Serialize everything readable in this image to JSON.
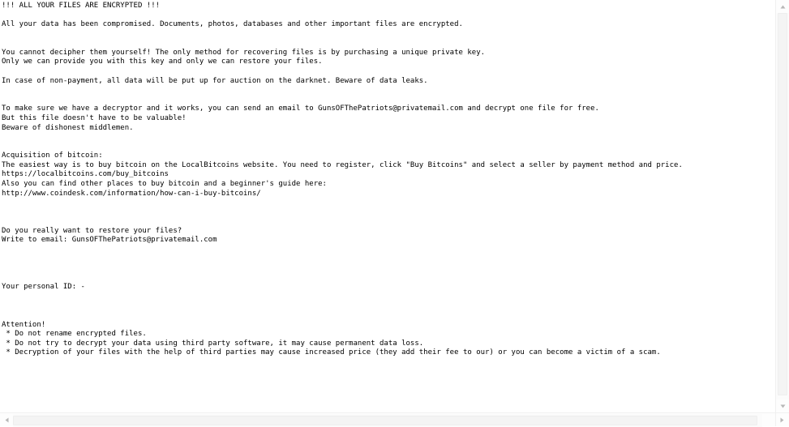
{
  "document": {
    "type": "plain-text-ransom-note",
    "lines": [
      "!!! ALL YOUR FILES ARE ENCRYPTED !!!",
      "",
      "All your data has been compromised. Documents, photos, databases and other important files are encrypted.",
      "",
      "",
      "You cannot decipher them yourself! The only method for recovering files is by purchasing a unique private key.",
      "Only we can provide you with this key and only we can restore your files.",
      "",
      "In case of non-payment, all data will be put up for auction on the darknet. Beware of data leaks.",
      "",
      "",
      "To make sure we have a decryptor and it works, you can send an email to GunsOFThePatriots@privatemail.com and decrypt one file for free.",
      "But this file doesn't have to be valuable!",
      "Beware of dishonest middlemen.",
      "",
      "",
      "Acquisition of bitcoin:",
      "The easiest way is to buy bitcoin on the LocalBitcoins website. You need to register, click \"Buy Bitcoins\" and select a seller by payment method and price.",
      "https://localbitcoins.com/buy_bitcoins",
      "Also you can find other places to buy bitcoin and a beginner's guide here:",
      "http://www.coindesk.com/information/how-can-i-buy-bitcoins/",
      "",
      "",
      "",
      "Do you really want to restore your files?",
      "Write to email: GunsOFThePatriots@privatemail.com",
      "",
      "",
      "",
      "",
      "Your personal ID: -",
      "",
      "",
      "",
      "Attention!",
      " * Do not rename encrypted files.",
      " * Do not try to decrypt your data using third party software, it may cause permanent data loss.",
      " * Decryption of your files with the help of third parties may cause increased price (they add their fee to our) or you can become a victim of a scam."
    ],
    "headline": "!!! ALL YOUR FILES ARE ENCRYPTED !!!",
    "contact_email": "GunsOFThePatriots@privatemail.com",
    "personal_id": "-",
    "links": [
      "https://localbitcoins.com/buy_bitcoins",
      "http://www.coindesk.com/information/how-can-i-buy-bitcoins/"
    ],
    "warnings": [
      "Do not rename encrypted files.",
      "Do not try to decrypt your data using third party software, it may cause permanent data loss.",
      "Decryption of your files with the help of third parties may cause increased price (they add their fee to our) or you can become a victim of a scam."
    ]
  },
  "colors": {
    "text": "#000000",
    "background": "#ffffff",
    "scrollbar_track": "#fbfbfb",
    "scrollbar_thumb": "#f4f4f4",
    "scrollbar_arrow": "#b8b8b8"
  },
  "scrollbars": {
    "vertical": {
      "up_arrow_icon": "chevron-up-icon",
      "down_arrow_icon": "chevron-down-icon"
    },
    "horizontal": {
      "left_arrow_icon": "chevron-left-icon",
      "right_arrow_icon": "chevron-right-icon"
    }
  }
}
